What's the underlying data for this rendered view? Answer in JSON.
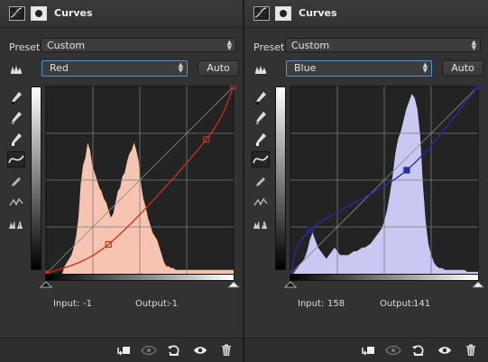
{
  "panels": [
    {
      "title": "Curves",
      "preset_label": "Preset:",
      "preset_value": "Custom",
      "channel": "Red",
      "auto_label": "Auto",
      "input_label": "Input:",
      "input_value": "-1",
      "output_label": "Output:",
      "output_value": "-1",
      "histogram_color": "#f6c4b0",
      "curve_color": "#c8301e",
      "histogram": [
        0,
        0,
        0,
        0,
        0,
        0,
        0,
        0,
        4,
        6,
        8,
        10,
        14,
        20,
        30,
        48,
        58,
        62,
        70,
        66,
        58,
        54,
        50,
        46,
        44,
        40,
        38,
        34,
        30,
        32,
        38,
        44,
        46,
        52,
        54,
        60,
        64,
        66,
        70,
        66,
        60,
        48,
        40,
        36,
        30,
        26,
        22,
        20,
        18,
        14,
        10,
        6,
        4,
        4,
        3,
        3,
        2,
        2,
        2,
        2,
        2,
        2,
        2,
        2,
        2,
        2,
        2,
        2,
        2,
        2,
        2,
        2,
        2,
        2,
        2,
        2,
        2,
        2,
        2,
        2,
        2,
        2
      ],
      "curve_points": [
        [
          0,
          0
        ],
        [
          85,
          40
        ],
        [
          218,
          183
        ],
        [
          255,
          255
        ]
      ],
      "selected_point": 0
    },
    {
      "title": "Curves",
      "preset_label": "Preset:",
      "preset_value": "Custom",
      "channel": "Blue",
      "auto_label": "Auto",
      "input_label": "Input:",
      "input_value": "158",
      "output_label": "Output:",
      "output_value": "141",
      "histogram_color": "#c8c8f2",
      "curve_color": "#2a2aa8",
      "histogram": [
        0,
        0,
        2,
        4,
        6,
        8,
        12,
        18,
        22,
        18,
        14,
        12,
        10,
        8,
        10,
        12,
        14,
        12,
        10,
        10,
        10,
        10,
        11,
        12,
        12,
        13,
        14,
        14,
        15,
        16,
        18,
        20,
        22,
        24,
        28,
        34,
        42,
        52,
        64,
        72,
        76,
        82,
        88,
        92,
        96,
        94,
        88,
        74,
        48,
        28,
        16,
        10,
        6,
        4,
        3,
        3,
        2,
        2,
        2,
        2,
        2,
        2,
        2,
        2,
        1,
        1,
        1,
        1,
        1
      ],
      "curve_points": [
        [
          0,
          0
        ],
        [
          27,
          60
        ],
        [
          158,
          141
        ],
        [
          255,
          255
        ]
      ],
      "selected_point": 2
    }
  ],
  "tools": [
    "channel-picker-icon",
    "black-eyedropper-icon",
    "gray-eyedropper-icon",
    "white-eyedropper-icon",
    "curve-edit-icon",
    "pencil-icon",
    "smooth-icon",
    "clipping-warning-icon"
  ],
  "footer_buttons": [
    "clip-to-layer-icon",
    "view-previous-icon",
    "reset-icon",
    "visibility-eye-icon",
    "trash-icon"
  ]
}
